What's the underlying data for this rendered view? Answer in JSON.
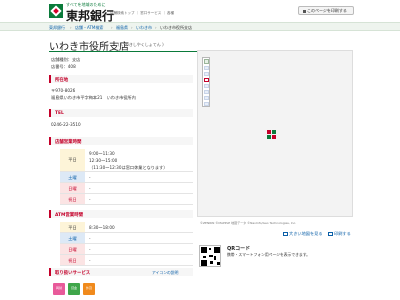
{
  "header": {
    "tagline": "すべてを地域のために",
    "bank_name": "東邦銀行",
    "links": "店舗検索トップ ｜ 窓口サービス ｜ 各種",
    "print_button": "このページを印刷する"
  },
  "breadcrumb": [
    "東邦銀行",
    "店舗・ATM検索",
    "福島県",
    "いわき市",
    "いわき市役所支店"
  ],
  "branch": {
    "name": "いわき市役所支店",
    "kana": "( いわきしやくしょてん )",
    "type_line": "店舗種別：支店",
    "number_line": "店番号：408"
  },
  "sections": {
    "address": {
      "heading": "所在地",
      "postal": "〒970-8026",
      "address": "福島県いわき市平字梅本21　いわき市役所内"
    },
    "tel": {
      "heading": "TEL",
      "number": "0246-22-3510"
    },
    "hours": {
      "heading": "店舗営業時間",
      "rows": [
        {
          "day": "平日",
          "lines": [
            "9:00～11:30",
            "12:30～15:00",
            "（11:30～12:30は窓口休業となります）"
          ]
        },
        {
          "day": "土曜",
          "lines": [
            "-"
          ]
        },
        {
          "day": "日曜",
          "lines": [
            "-"
          ]
        },
        {
          "day": "祝日",
          "lines": [
            "-"
          ]
        }
      ]
    },
    "atm": {
      "heading": "ATM営業時間",
      "rows": [
        {
          "day": "平日",
          "lines": [
            "8:30～18:00"
          ]
        },
        {
          "day": "土曜",
          "lines": [
            "-"
          ]
        },
        {
          "day": "日曜",
          "lines": [
            "-"
          ]
        },
        {
          "day": "祝日",
          "lines": [
            "-"
          ]
        }
      ]
    },
    "services": {
      "heading": "取り扱いサービス",
      "link": "アイコンの説明",
      "icons": [
        {
          "label": "両替",
          "color": "#e85a9a"
        },
        {
          "label": "貸金",
          "color": "#3fa64a"
        },
        {
          "label": "外貨",
          "color": "#f08a1c"
        }
      ]
    }
  },
  "map": {
    "credit": "©ZENRIN ©MAPPLE 地図データ ©NavInfo/Geo Technologies, Inc.",
    "large_map_link": "大きい地図を見る",
    "print_link": "印刷する"
  },
  "qr": {
    "title": "QRコード",
    "desc": "携帯・スマートフォン用ページを表示できます。"
  },
  "colors": {
    "brand_green": "#0a7a3a",
    "accent_red": "#c4002a",
    "link_blue": "#0a5fa8"
  }
}
